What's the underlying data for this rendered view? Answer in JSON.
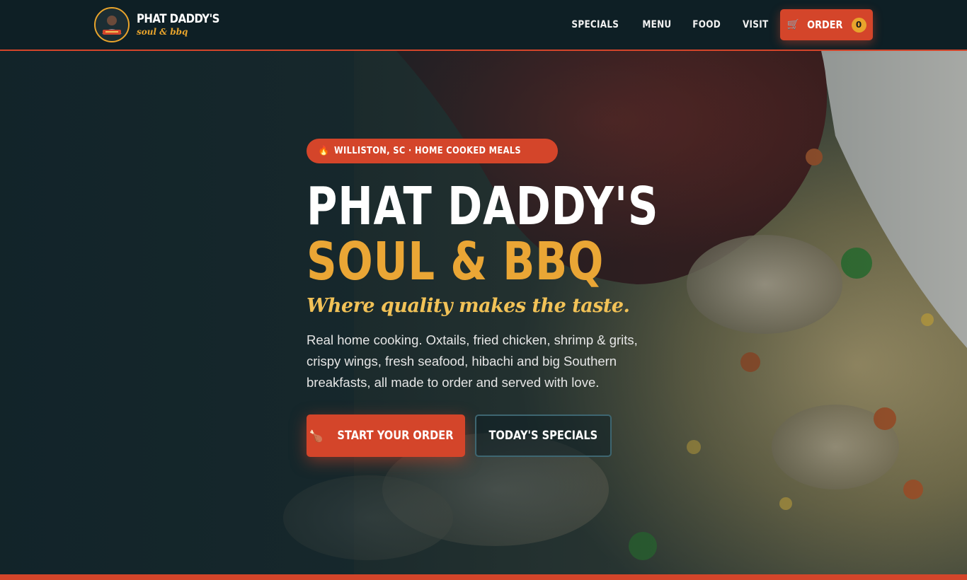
{
  "nav": {
    "logo_title": "PHAT DADDY'S",
    "logo_subtitle": "soul & bbq",
    "links": [
      "SPECIALS",
      "MENU",
      "FOOD",
      "VISIT"
    ],
    "order_label": "ORDER",
    "cart_count": "0",
    "cart_icon": "cart-icon"
  },
  "hero": {
    "badge": "WILLISTON, SC · HOME COOKED MEALS",
    "badge_icon": "fire-icon",
    "title_line1": "PHAT DADDY'S",
    "title_line2": "SOUL & BBQ",
    "tagline": "Where quality makes the taste.",
    "description": "Real home cooking. Oxtails, fried chicken, shrimp & grits, crispy wings, fresh seafood, hibachi and big Southern breakfasts, all made to order and served with love.",
    "primary_button": "START YOUR ORDER",
    "primary_icon": "drumstick-icon",
    "secondary_button": "TODAY'S SPECIALS"
  },
  "colors": {
    "accent": "#d4452a",
    "gold": "#eaa635",
    "navy": "#0e1f25"
  }
}
